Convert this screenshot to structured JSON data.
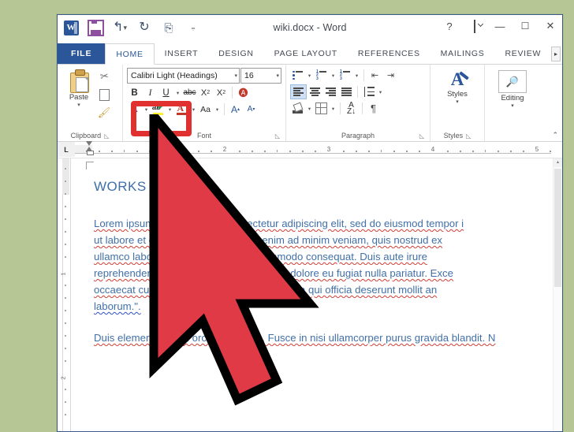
{
  "window": {
    "title": "wiki.docx - Word",
    "app": "Word",
    "background_color": "#b6c795",
    "accent_color": "#2b579a"
  },
  "quick_access": {
    "items": [
      {
        "name": "word-logo",
        "label": "W"
      },
      {
        "name": "save-icon",
        "label": ""
      },
      {
        "name": "undo-icon",
        "label": "↰"
      },
      {
        "name": "redo-icon",
        "label": "↻"
      },
      {
        "name": "touch-mode-icon",
        "label": ""
      },
      {
        "name": "customize-qat-icon",
        "label": "▾"
      }
    ]
  },
  "window_controls": {
    "help": "?",
    "ribbon_options": "ribbon-display-icon",
    "minimize": "—",
    "restore": "☐",
    "close": "✕"
  },
  "tabs": [
    {
      "label": "FILE",
      "state": "file"
    },
    {
      "label": "HOME",
      "state": "active"
    },
    {
      "label": "INSERT",
      "state": "normal"
    },
    {
      "label": "DESIGN",
      "state": "normal"
    },
    {
      "label": "PAGE LAYOUT",
      "state": "normal"
    },
    {
      "label": "REFERENCES",
      "state": "normal"
    },
    {
      "label": "MAILINGS",
      "state": "normal"
    },
    {
      "label": "REVIEW",
      "state": "normal"
    }
  ],
  "tab_overflow": "▸",
  "ribbon": {
    "clipboard": {
      "label": "Clipboard",
      "paste_label": "Paste",
      "paste_caret": "▾",
      "cut": "✂",
      "copy": "copy-icon",
      "format_painter": "🖌",
      "dialog_launcher": "◺"
    },
    "font": {
      "label": "Font",
      "font_name": "Calibri Light (Headings)",
      "font_size": "16",
      "caret": "▾",
      "bold": "B",
      "italic": "I",
      "underline": "U",
      "strikethrough": "abc",
      "subscript": "X₂",
      "superscript": "X²",
      "clear_formatting": "clear-formatting-icon",
      "text_effects": "A",
      "text_highlight_color": "text-highlight-color-icon",
      "font_color": "A",
      "change_case": "Aa",
      "grow_font": "A",
      "shrink_font": "A",
      "dialog_launcher": "◺",
      "highlighted_button": "text-highlight-color"
    },
    "paragraph": {
      "label": "Paragraph",
      "bullets": "bullets-icon",
      "numbering": "numbering-icon",
      "multilevel": "multilevel-list-icon",
      "decrease_indent": "⇤",
      "increase_indent": "⇥",
      "align_left": "align-left-icon",
      "align_center": "align-center-icon",
      "align_right": "align-right-icon",
      "justify": "justify-icon",
      "line_spacing": "line-spacing-icon",
      "shading": "shading-icon",
      "borders": "borders-icon",
      "sort": "sort-icon",
      "show_marks": "¶",
      "dialog_launcher": "◺"
    },
    "styles": {
      "label": "Styles",
      "button_label": "Styles",
      "caret": "▾",
      "dialog_launcher": "◺"
    },
    "editing": {
      "label": "",
      "button_label": "Editing",
      "caret": "▾",
      "icon": "binoculars-icon"
    },
    "collapse_ribbon": "⌃"
  },
  "ruler": {
    "tab_stop_selector": "L",
    "horizontal_numbers": [
      "2",
      "3",
      "4",
      "5"
    ],
    "vertical_numbers": [
      "1",
      "2"
    ]
  },
  "document": {
    "heading": "WORKS CITED",
    "paragraphs": [
      "Lorem ipsum dolor sit amet, consectetur adipiscing elit, sed do eiusmod tempor i",
      "ut  labore  et  dolore  magna  aliqua.  Ut  enim  ad  minim  veniam,  quis  nostrud  ex",
      "ullamco  laboris  nisi  ut  aliquip  ex  ea  commodo  consequat.  Duis  aute  irure",
      "reprehenderit  in  voluptate  velit  esse  cillum  dolore  eu  fugiat  nulla  pariatur.  Exce",
      "occaecat  cupidatat  non  proident,  sunt  in  culpa  qui  officia  deserunt  mollit  an",
      "laborum.\".",
      "Duis elementum non orci vel congue. Fusce in nisi ullamcorper purus gravida blandit. N"
    ],
    "text_color": "#4170a8",
    "spellcheck_underline_color": "#d23b32",
    "grammar_underline_color": "#2b4fd0"
  },
  "annotation": {
    "highlight_box_color": "#e03030",
    "cursor_color": "#e03a46",
    "cursor_outline": "#000000",
    "target": "text-highlight-color-button"
  }
}
